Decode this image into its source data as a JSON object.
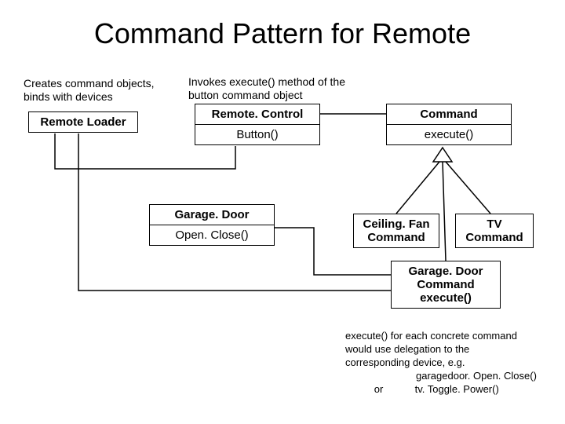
{
  "title": "Command Pattern for Remote",
  "notes": {
    "loader": "Creates command objects, binds with devices",
    "remote": "Invokes execute() method of the button command object"
  },
  "boxes": {
    "remoteLoader": {
      "name": "Remote Loader"
    },
    "remoteControl": {
      "name": "Remote. Control",
      "method": "Button()"
    },
    "command": {
      "name": "Command",
      "method": "execute()"
    },
    "garageDoor": {
      "name": "Garage. Door",
      "method": "Open. Close()"
    },
    "ceilingFanCmd": {
      "line1": "Ceiling. Fan",
      "line2": "Command"
    },
    "tvCmd": {
      "line1": "TV",
      "line2": "Command"
    },
    "garageDoorCmd": {
      "line1": "Garage. Door",
      "line2": "Command",
      "line3": "execute()"
    }
  },
  "footer": {
    "l1": "execute() for each concrete command",
    "l2": "would use delegation to the",
    "l3": "corresponding device, e.g.",
    "l4": "garagedoor. Open. Close()",
    "l5a": "or",
    "l5b": "tv. Toggle. Power()"
  }
}
